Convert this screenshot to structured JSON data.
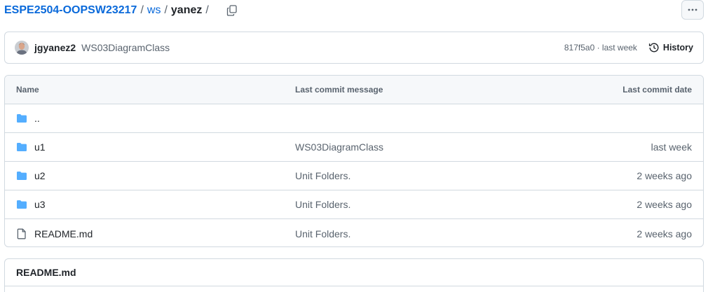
{
  "breadcrumb": {
    "repo": "ESPE2504-OOPSW23217",
    "folder": "ws",
    "current": "yanez",
    "separator": "/",
    "copy_icon": "copy-icon"
  },
  "more_button": {
    "icon": "kebab-horizontal-icon"
  },
  "commit": {
    "author": "jgyanez2",
    "message": "WS03DiagramClass",
    "meta": "817f5a0 · last week",
    "history_label": "History",
    "history_icon": "history-icon"
  },
  "table": {
    "headers": {
      "name": "Name",
      "message": "Last commit message",
      "date": "Last commit date"
    },
    "rows": [
      {
        "name": "..",
        "type": "folder",
        "message": "",
        "date": ""
      },
      {
        "name": "u1",
        "type": "folder",
        "message": "WS03DiagramClass",
        "date": "last week"
      },
      {
        "name": "u2",
        "type": "folder",
        "message": "Unit Folders.",
        "date": "2 weeks ago"
      },
      {
        "name": "u3",
        "type": "folder",
        "message": "Unit Folders.",
        "date": "2 weeks ago"
      },
      {
        "name": "README.md",
        "type": "file",
        "message": "Unit Folders.",
        "date": "2 weeks ago"
      }
    ]
  },
  "readme": {
    "title": "README.md"
  },
  "colors": {
    "link": "#0969da",
    "folder": "#54aeff",
    "muted": "#59636e",
    "border": "#d1d9e0",
    "header_bg": "#f6f8fa"
  }
}
